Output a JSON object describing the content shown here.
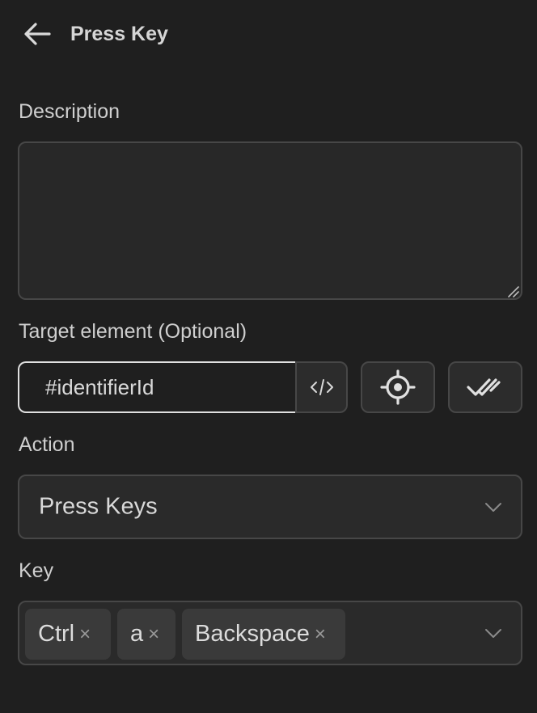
{
  "header": {
    "back_icon": "arrow-left-icon",
    "title": "Press Key"
  },
  "description": {
    "label": "Description",
    "value": ""
  },
  "target": {
    "label": "Target element (Optional)",
    "value": "#identifierId",
    "code_icon": "code-icon",
    "pick_icon": "crosshair-icon",
    "verify_icon": "double-check-icon"
  },
  "action": {
    "label": "Action",
    "value": "Press Keys",
    "chevron_icon": "chevron-down-icon"
  },
  "key": {
    "label": "Key",
    "tags": [
      {
        "label": "Ctrl",
        "remove": "×"
      },
      {
        "label": "a",
        "remove": "×"
      },
      {
        "label": "Backspace",
        "remove": "×"
      }
    ],
    "chevron_icon": "chevron-down-icon"
  },
  "colors": {
    "background": "#1f1f1f",
    "field_background": "#2a2a2a",
    "border": "#474747",
    "focus_border": "#e0e0e0",
    "tag_background": "#3a3a3a"
  }
}
